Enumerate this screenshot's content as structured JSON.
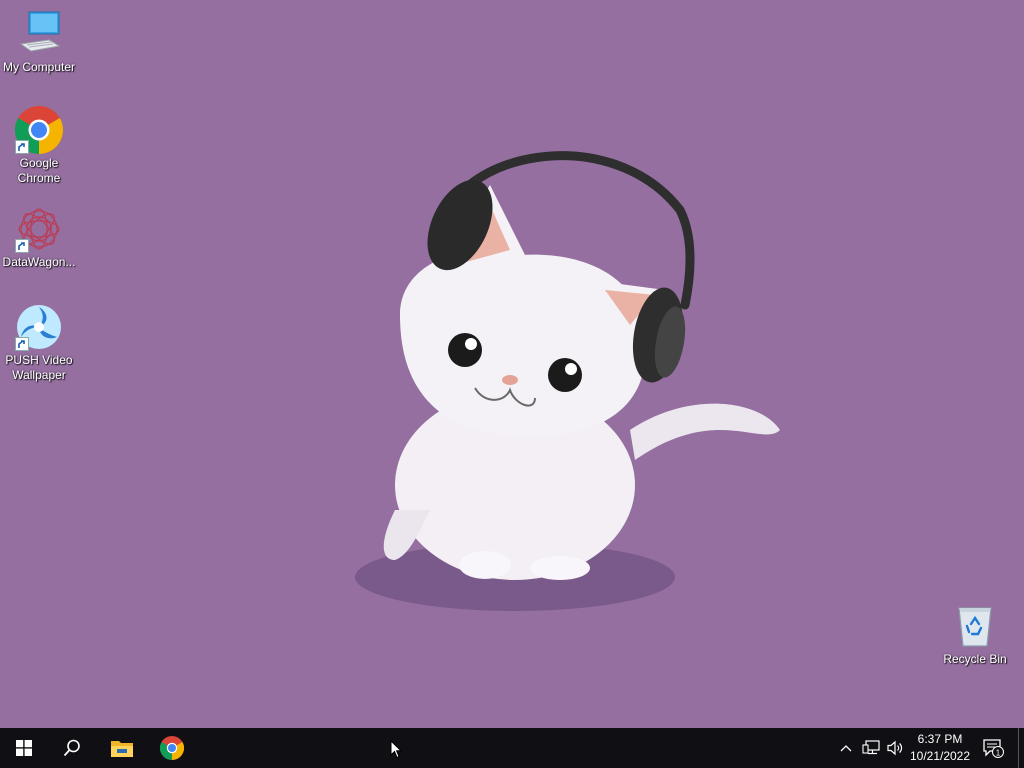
{
  "desktop": {
    "background_color": "#946fa0",
    "wallpaper": "white-cat-with-headphones",
    "icons": [
      {
        "label": "My Computer",
        "icon": "computer-icon"
      },
      {
        "label": "Google Chrome",
        "icon": "chrome-icon"
      },
      {
        "label": "DataWagon...",
        "icon": "datawagon-icon"
      },
      {
        "label": "PUSH Video Wallpaper",
        "icon": "push-video-wallpaper-icon"
      },
      {
        "label": "Recycle Bin",
        "icon": "recycle-bin-icon"
      }
    ]
  },
  "taskbar": {
    "background_color": "#0f0f14",
    "pinned": [
      {
        "name": "start",
        "icon": "windows-logo-icon"
      },
      {
        "name": "search",
        "icon": "search-icon"
      },
      {
        "name": "file-explorer",
        "icon": "folder-icon"
      },
      {
        "name": "google-chrome",
        "icon": "chrome-icon"
      }
    ],
    "tray": {
      "time": "6:37 PM",
      "date": "10/21/2022",
      "notification_count": "1"
    }
  }
}
